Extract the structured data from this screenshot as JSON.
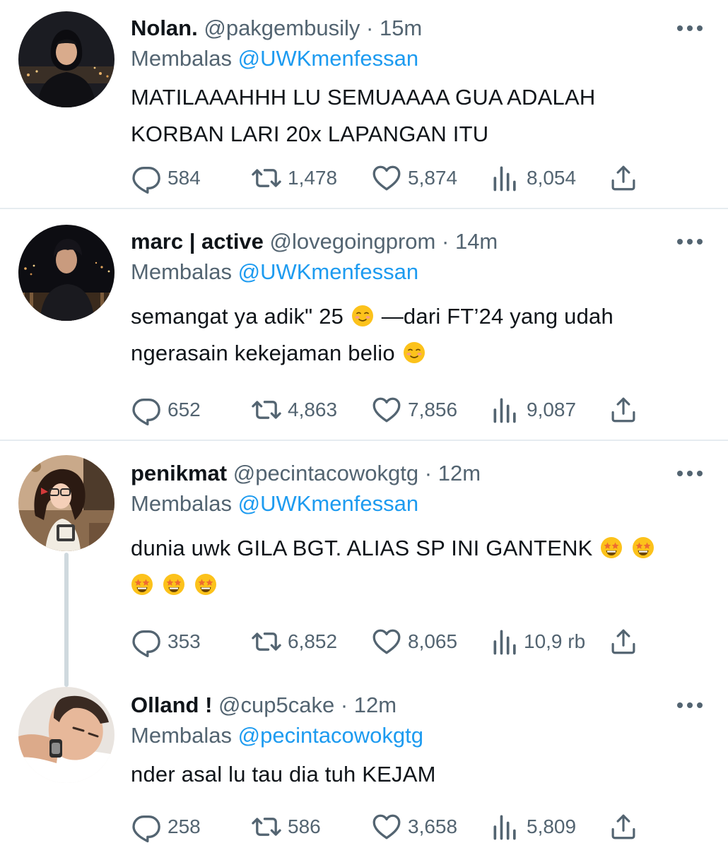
{
  "tweets": [
    {
      "display_name": "Nolan.",
      "handle": "@pakgembusily",
      "separator": "·",
      "time": "15m",
      "reply_prefix": "Membalas",
      "reply_to": "@UWKmenfessan",
      "text_lines": [
        "MATILAAAHHH LU SEMUAAAA GUA ADALAH",
        "KORBAN LARI 20x LAPANGAN ITU"
      ],
      "replies": "584",
      "retweets": "1,478",
      "likes": "5,874",
      "views": "8,054"
    },
    {
      "display_name": "marc | active",
      "handle": "@lovegoingprom",
      "separator": "·",
      "time": "14m",
      "reply_prefix": "Membalas",
      "reply_to": "@UWKmenfessan",
      "text_line1_a": "semangat ya adik\" 25",
      "text_line1_b": "—dari FT’24 yang udah",
      "text_line2": "ngerasain kekejaman belio",
      "replies": "652",
      "retweets": "4,863",
      "likes": "7,856",
      "views": "9,087"
    },
    {
      "display_name": "penikmat",
      "handle": "@pecintacowokgtg",
      "separator": "·",
      "time": "12m",
      "reply_prefix": "Membalas",
      "reply_to": "@UWKmenfessan",
      "text_line1": "dunia uwk GILA BGT. ALIAS SP INI GANTENK",
      "replies": "353",
      "retweets": "6,852",
      "likes": "8,065",
      "views": "10,9 rb"
    },
    {
      "display_name": "Olland !",
      "handle": "@cup5cake",
      "separator": "·",
      "time": "12m",
      "reply_prefix": "Membalas",
      "reply_to": "@pecintacowokgtg",
      "text_line1": "nder asal lu tau dia tuh KEJAM",
      "replies": "258",
      "retweets": "586",
      "likes": "3,658",
      "views": "5,809"
    }
  ],
  "icons": {
    "reply": "speech-bubble-icon",
    "retweet": "retweet-arrows-icon",
    "like": "heart-icon",
    "views": "bar-chart-icon",
    "share": "share-upload-icon",
    "more": "more-dots-icon",
    "smile_emoji": "smiling-face-emoji",
    "star_struck_emoji": "star-struck-emoji"
  },
  "colors": {
    "link": "#1d9bf0",
    "secondary_text": "#536471",
    "primary_text": "#0f1419",
    "divider": "#e6ecf0"
  }
}
